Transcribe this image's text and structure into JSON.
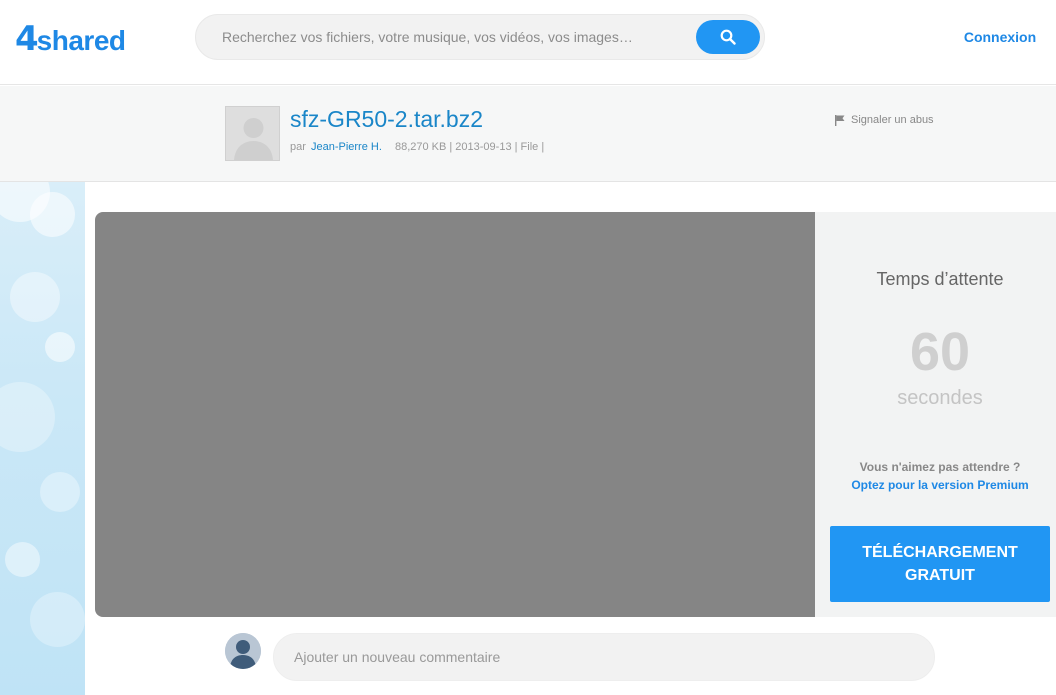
{
  "header": {
    "logo_number": "4",
    "logo_word": "shared",
    "search_placeholder": "Recherchez vos fichiers, votre musique, vos vidéos, vos images…",
    "login_label": "Connexion"
  },
  "file": {
    "title": "sfz-GR50-2.tar.bz2",
    "by_label": "par",
    "author": "Jean-Pierre H.",
    "details": "88,270 KB | 2013-09-13 | File |",
    "report_label": "Signaler un abus"
  },
  "wait": {
    "title": "Temps d’attente",
    "count": "60",
    "unit": "secondes",
    "question": "Vous n'aimez pas attendre ?",
    "premium_link": "Optez pour la version Premium",
    "download_label": "TÉLÉCHARGEMENT GRATUIT"
  },
  "comment": {
    "placeholder": "Ajouter un nouveau commentaire"
  },
  "colors": {
    "accent": "#2196f3",
    "link": "#1a86c8",
    "preview_bg": "#858585"
  }
}
